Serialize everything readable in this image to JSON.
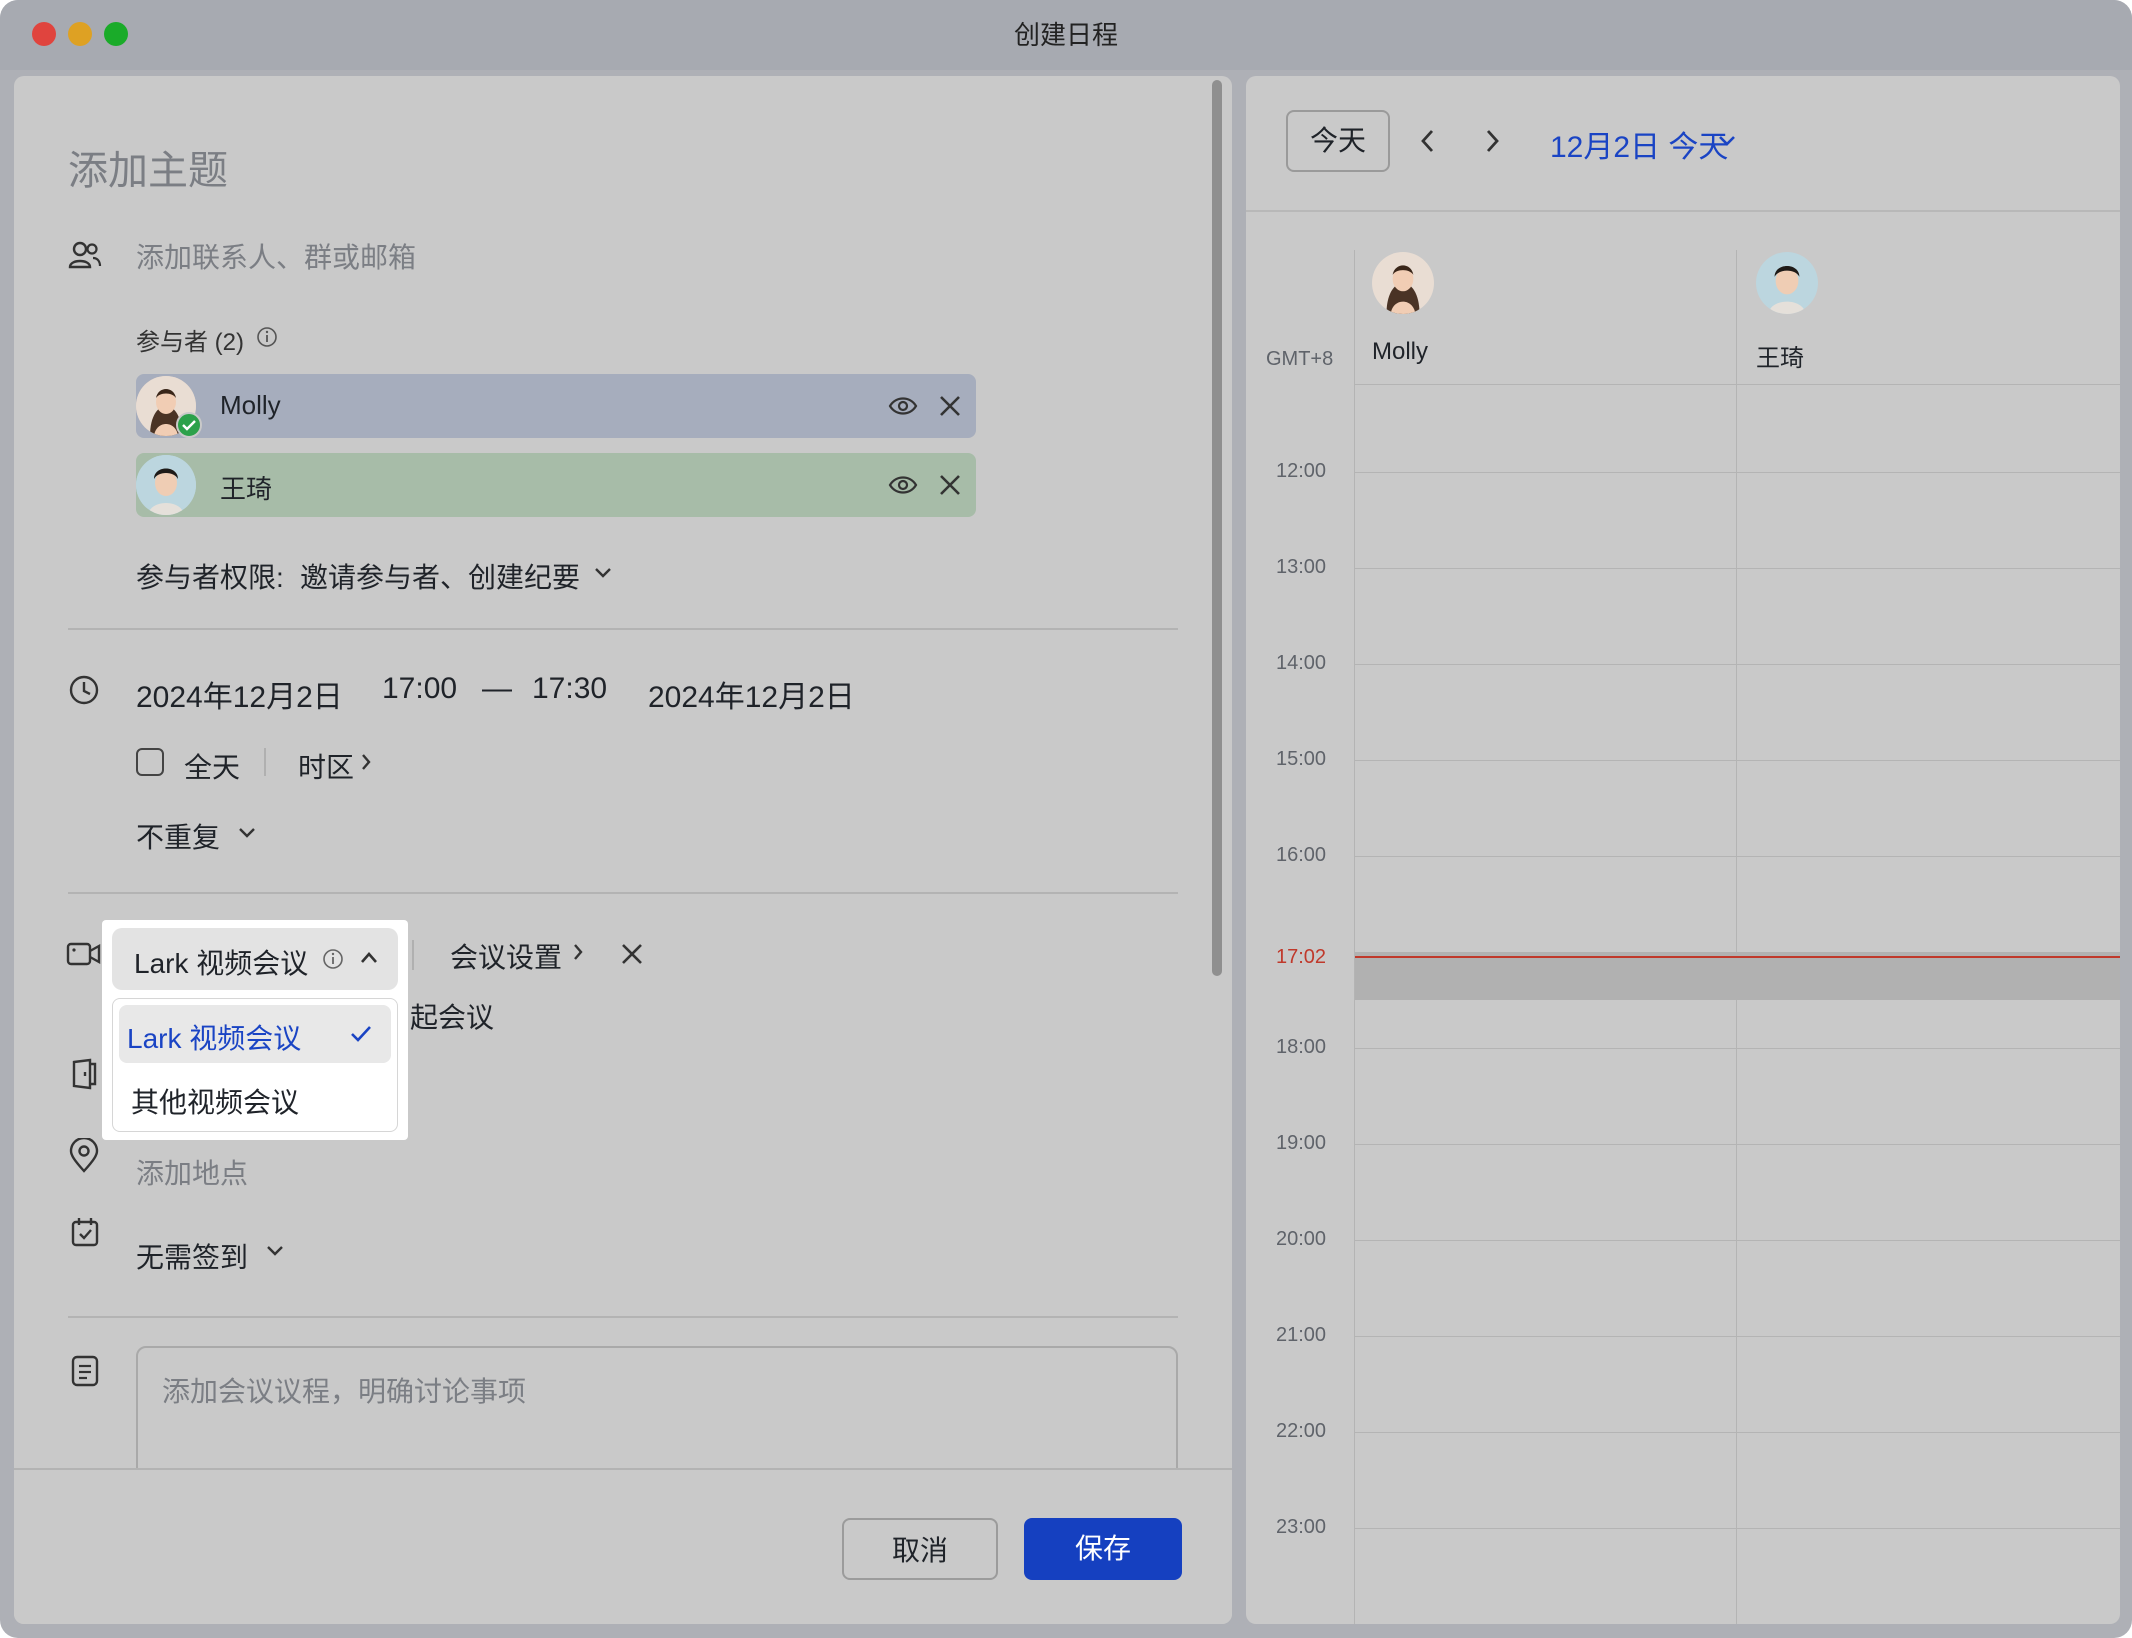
{
  "window": {
    "title": "创建日程"
  },
  "form": {
    "subject_placeholder": "添加主题",
    "contact_placeholder": "添加联系人、群或邮箱",
    "participants_label": "参与者 (2)",
    "participants": [
      {
        "name": "Molly",
        "color": "#a6adbd"
      },
      {
        "name": "王琦",
        "color": "#a7bca8"
      }
    ],
    "permission_label": "参与者权限:",
    "permission_value": "邀请参与者、创建纪要",
    "start_date": "2024年12月2日",
    "start_time": "17:00",
    "dash": "—",
    "end_time": "17:30",
    "end_date": "2024年12月2日",
    "allday_label": "全天",
    "timezone_label": "时区",
    "repeat_label": "不重复",
    "video_selected": "Lark 视频会议",
    "meeting_settings": "会议设置",
    "partial_behind_text": "起会议",
    "location_placeholder": "添加地点",
    "checkin_label": "无需签到",
    "agenda_placeholder": "添加会议议程，明确讨论事项",
    "cancel_label": "取消",
    "save_label": "保存"
  },
  "dropdown": {
    "options": [
      {
        "label": "Lark 视频会议",
        "selected": true
      },
      {
        "label": "其他视频会议",
        "selected": false
      }
    ]
  },
  "calendar": {
    "today_button": "今天",
    "date_title": "12月2日 今天",
    "timezone": "GMT+8",
    "people": [
      {
        "name": "Molly"
      },
      {
        "name": "王琦"
      }
    ],
    "hours": [
      "12:00",
      "13:00",
      "14:00",
      "15:00",
      "16:00",
      "18:00",
      "19:00",
      "20:00",
      "21:00",
      "22:00",
      "23:00"
    ],
    "now_label": "17:02"
  },
  "colors": {
    "accent": "#1a44c4",
    "save_button": "#1540c0",
    "now_line": "#c0392b"
  }
}
